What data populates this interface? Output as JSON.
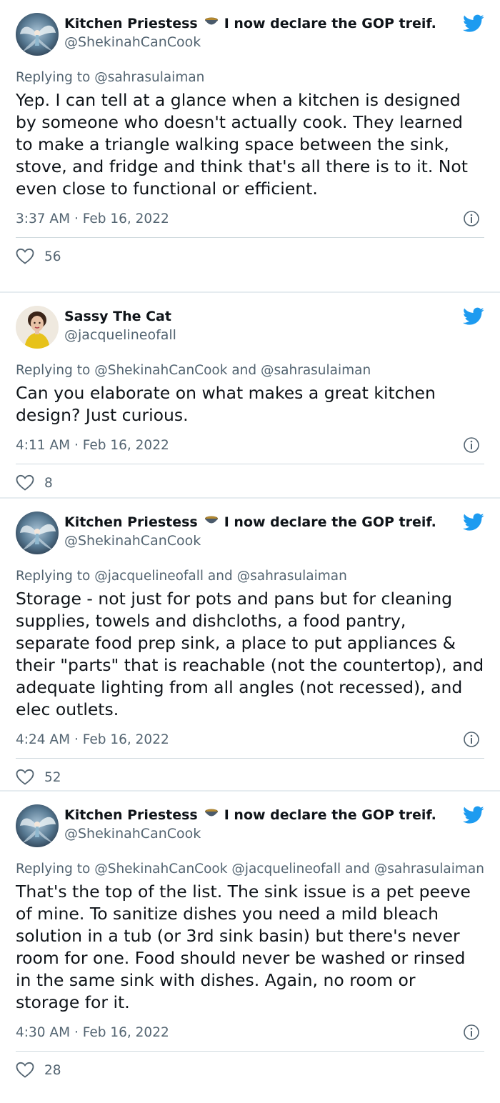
{
  "tweets": [
    {
      "author": {
        "name": "Kitchen Priestess",
        "tagline": "I now declare the GOP treif.",
        "handle": "@ShekinahCanCook",
        "avatar": "fairy-avatar"
      },
      "reply_to_label": "Replying to",
      "reply_to": "@sahrasulaiman",
      "text": "Yep. I can tell at a glance when a kitchen is designed by someone who doesn't actually cook. They learned to make a triangle walking space between the sink, stove, and fridge and think that's all there is to it. Not even close to functional or efficient.",
      "time": "3:37 AM",
      "date": "Feb 16, 2022",
      "likes": "56"
    },
    {
      "author": {
        "name": "Sassy The Cat",
        "tagline": "",
        "handle": "@jacquelineofall",
        "avatar": "woman-avatar"
      },
      "reply_to_label": "Replying to",
      "reply_to": "@ShekinahCanCook and @sahrasulaiman",
      "text": "Can you elaborate on what makes a great kitchen design? Just curious.",
      "time": "4:11 AM",
      "date": "Feb 16, 2022",
      "likes": "8"
    },
    {
      "author": {
        "name": "Kitchen Priestess",
        "tagline": "I now declare the GOP treif.",
        "handle": "@ShekinahCanCook",
        "avatar": "fairy-avatar"
      },
      "reply_to_label": "Replying to",
      "reply_to": "@jacquelineofall and @sahrasulaiman",
      "text": "Storage - not just for pots and pans but for cleaning supplies, towels and dishcloths, a food pantry, separate food prep sink, a place to put appliances & their \"parts\" that is reachable (not the countertop), and adequate lighting from all angles (not recessed), and elec outlets.",
      "time": "4:24 AM",
      "date": "Feb 16, 2022",
      "likes": "52"
    },
    {
      "author": {
        "name": "Kitchen Priestess",
        "tagline": "I now declare the GOP treif.",
        "handle": "@ShekinahCanCook",
        "avatar": "fairy-avatar"
      },
      "reply_to_label": "Replying to",
      "reply_to": "@ShekinahCanCook @jacquelineofall and @sahrasulaiman",
      "text": "That's the top of the list. The sink issue is a pet peeve of mine. To sanitize dishes you need a mild bleach solution in a tub (or 3rd sink basin) but there's never room for one. Food should never be washed or rinsed in the same sink with dishes. Again, no room or storage for it.",
      "time": "4:30 AM",
      "date": "Feb 16, 2022",
      "likes": "28"
    }
  ],
  "meta_separator": "·",
  "colors": {
    "twitter_blue": "#1d9bf0",
    "secondary_text": "#536471",
    "divider": "#cfd9de"
  }
}
